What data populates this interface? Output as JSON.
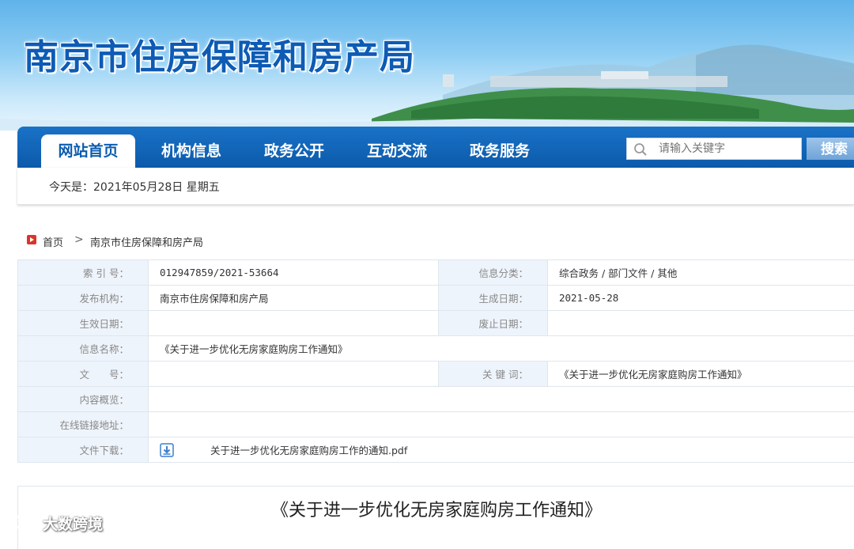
{
  "header": {
    "site_title": "南京市住房保障和房产局"
  },
  "nav": {
    "items": [
      {
        "label": "网站首页",
        "active": true
      },
      {
        "label": "机构信息",
        "active": false
      },
      {
        "label": "政务公开",
        "active": false
      },
      {
        "label": "互动交流",
        "active": false
      },
      {
        "label": "政务服务",
        "active": false
      }
    ],
    "search_placeholder": "请输入关键字",
    "search_button": "搜索"
  },
  "datebar": {
    "text": "今天是：2021年05月28日  星期五"
  },
  "breadcrumb": {
    "home": "首页",
    "separator": ">",
    "current": "南京市住房保障和房产局"
  },
  "info": {
    "index_label": "索 引 号：",
    "index_value": "012947859/2021-53664",
    "category_label": "信息分类：",
    "category_value": "综合政务 / 部门文件 / 其他",
    "publisher_label": "发布机构：",
    "publisher_value": "南京市住房保障和房产局",
    "created_label": "生成日期：",
    "created_value": "2021-05-28",
    "effective_label": "生效日期：",
    "effective_value": "",
    "expired_label": "废止日期：",
    "expired_value": "",
    "name_label": "信息名称：",
    "name_value": "《关于进一步优化无房家庭购房工作通知》",
    "docno_label": "文　　号：",
    "docno_value": "",
    "keywords_label": "关 键 词：",
    "keywords_value": "《关于进一步优化无房家庭购房工作通知》",
    "summary_label": "内容概览：",
    "summary_value": "",
    "link_label": "在线链接地址：",
    "link_value": "",
    "download_label": "文件下载：",
    "download_file": "关于进一步优化无房家庭购房工作的通知.pdf"
  },
  "article": {
    "title": "《关于进一步优化无房家庭购房工作通知》"
  },
  "watermark": {
    "text": "大数跨境"
  },
  "colors": {
    "nav_blue": "#0c5aab",
    "title_blue": "#0d5bb5",
    "label_bg": "#eef4fb",
    "border": "#dfe6ee"
  }
}
